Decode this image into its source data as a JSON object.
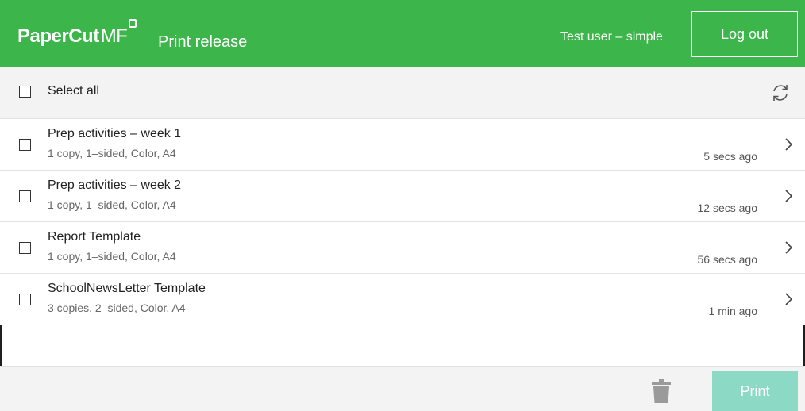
{
  "header": {
    "logo_text": "PaperCut",
    "logo_suffix": "MF",
    "title": "Print release",
    "user": "Test user – simple",
    "logout_label": "Log out"
  },
  "toolbar": {
    "select_all_label": "Select all",
    "refresh_icon": "refresh-icon"
  },
  "jobs": [
    {
      "name": "Prep activities – week 1",
      "details": "1 copy, 1–sided, Color, A4",
      "time": "5 secs ago"
    },
    {
      "name": "Prep activities – week 2",
      "details": "1 copy, 1–sided, Color, A4",
      "time": "12 secs ago"
    },
    {
      "name": "Report Template",
      "details": "1 copy, 1–sided, Color, A4",
      "time": "56 secs ago"
    },
    {
      "name": "SchoolNewsLetter Template",
      "details": "3 copies, 2–sided, Color, A4",
      "time": "1 min ago"
    }
  ],
  "footer": {
    "delete_icon": "trash-icon",
    "print_label": "Print"
  },
  "colors": {
    "brand_green": "#3cb54a",
    "print_button_disabled": "#8cd9c6",
    "panel_gray": "#f3f3f3"
  }
}
